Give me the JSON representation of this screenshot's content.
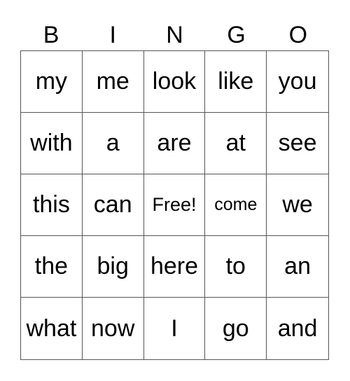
{
  "header": [
    "B",
    "I",
    "N",
    "G",
    "O"
  ],
  "cells": [
    "my",
    "me",
    "look",
    "like",
    "you",
    "with",
    "a",
    "are",
    "at",
    "see",
    "this",
    "can",
    "Free!",
    "come",
    "we",
    "the",
    "big",
    "here",
    "to",
    "an",
    "what",
    "now",
    "I",
    "go",
    "and"
  ]
}
